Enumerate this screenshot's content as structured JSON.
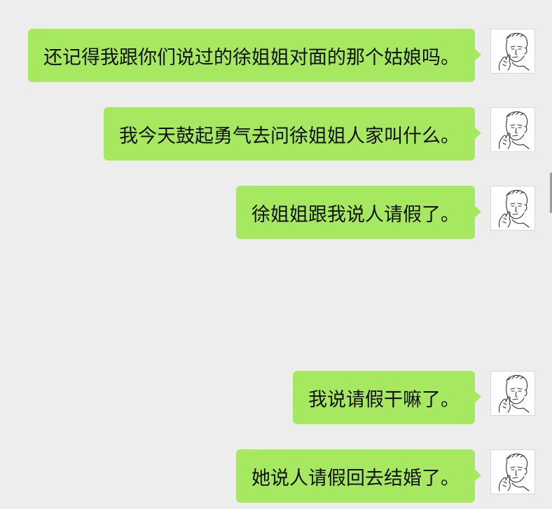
{
  "chat": {
    "messages": [
      {
        "sender": "self",
        "text": "还记得我跟你们说过的徐姐姐对面的那个姑娘吗。",
        "avatar_icon": "sketch-man-portrait-icon"
      },
      {
        "sender": "self",
        "text": "我今天鼓起勇气去问徐姐姐人家叫什么。",
        "avatar_icon": "sketch-man-portrait-icon"
      },
      {
        "sender": "self",
        "text": "徐姐姐跟我说人请假了。",
        "avatar_icon": "sketch-man-portrait-icon"
      },
      {
        "sender": "self",
        "text": "我说请假干嘛了。",
        "avatar_icon": "sketch-man-portrait-icon"
      },
      {
        "sender": "self",
        "text": "她说人请假回去结婚了。",
        "avatar_icon": "sketch-man-portrait-icon"
      }
    ]
  },
  "colors": {
    "background": "#ededed",
    "bubble": "#a6e860",
    "text": "#111111"
  }
}
